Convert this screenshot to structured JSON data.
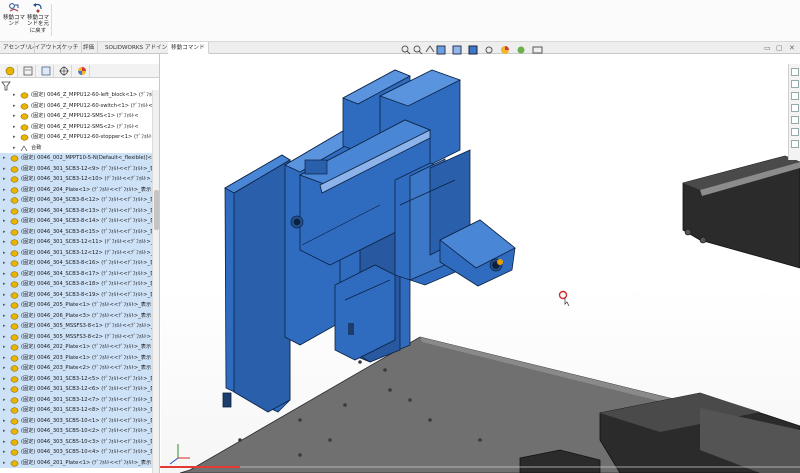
{
  "toolbar": {
    "buttons": [
      {
        "label": "移動コマ\nンド",
        "icon": "move-command-icon"
      },
      {
        "label": "移動コマ\nンドを元\nに戻す",
        "icon": "undo-move-icon"
      }
    ]
  },
  "tabs": [
    {
      "label": "アセンブリ",
      "active": false
    },
    {
      "label": "レイアウト",
      "active": false
    },
    {
      "label": "スケッチ",
      "active": false
    },
    {
      "label": "評価",
      "active": false
    },
    {
      "label": "SOLIDWORKS アドイン",
      "active": false
    },
    {
      "label": "移動コマンド",
      "active": true
    }
  ],
  "feature_tree": {
    "items": [
      {
        "text": "(固定) 0046_Z_MPPU12-60-left_block<1> (ﾃﾞﾌｫﾙﾄ<",
        "indent": 1,
        "sel": false
      },
      {
        "text": "(固定) 0046_Z_MPPU12-60-switch<1> (ﾃﾞﾌｫﾙﾄ<",
        "indent": 1,
        "sel": false
      },
      {
        "text": "(固定) 0046_Z_MPPU12-SMS<1> (ﾃﾞﾌｫﾙﾄ<",
        "indent": 1,
        "sel": false
      },
      {
        "text": "(固定) 0046_Z_MPPU12-SMS<2> (ﾃﾞﾌｫﾙﾄ<",
        "indent": 1,
        "sel": false
      },
      {
        "text": "(固定) 0046_Z_MPPU12-60-stopper<1> (ﾃﾞﾌｫﾙﾄ<",
        "indent": 1,
        "sel": false
      },
      {
        "text": "合致",
        "indent": 1,
        "sel": false,
        "mates": true
      },
      {
        "text": "(固定) 0046_002_MPPT10-5-N(Default<_flexible)]<1>",
        "indent": 0,
        "sel": true
      },
      {
        "text": "(固定) 0046_301_SCB3-12<9> (ﾃﾞﾌｫﾙﾄ<<ﾃﾞﾌｫﾙﾄ>_表示",
        "indent": 0,
        "sel": true
      },
      {
        "text": "(固定) 0046_301_SCB3-12<10> (ﾃﾞﾌｫﾙﾄ<<ﾃﾞﾌｫﾙﾄ>_表示",
        "indent": 0,
        "sel": true
      },
      {
        "text": "(固定) 0046_204_Plate<1> (ﾃﾞﾌｫﾙﾄ<<ﾃﾞﾌｫﾙﾄ>_表示",
        "indent": 0,
        "sel": true
      },
      {
        "text": "(固定) 0046_304_SCB3-8<12> (ﾃﾞﾌｫﾙﾄ<<ﾃﾞﾌｫﾙﾄ>_表示",
        "indent": 0,
        "sel": true
      },
      {
        "text": "(固定) 0046_304_SCB3-8<13> (ﾃﾞﾌｫﾙﾄ<<ﾃﾞﾌｫﾙﾄ>_表示",
        "indent": 0,
        "sel": true
      },
      {
        "text": "(固定) 0046_304_SCB3-8<14> (ﾃﾞﾌｫﾙﾄ<<ﾃﾞﾌｫﾙﾄ>_表示",
        "indent": 0,
        "sel": true
      },
      {
        "text": "(固定) 0046_304_SCB3-8<15> (ﾃﾞﾌｫﾙﾄ<<ﾃﾞﾌｫﾙﾄ>_表示",
        "indent": 0,
        "sel": true
      },
      {
        "text": "(固定) 0046_301_SCB3-12<11> (ﾃﾞﾌｫﾙﾄ<<ﾃﾞﾌｫﾙﾄ>_表示",
        "indent": 0,
        "sel": true
      },
      {
        "text": "(固定) 0046_301_SCB3-12<12> (ﾃﾞﾌｫﾙﾄ<<ﾃﾞﾌｫﾙﾄ>_表示",
        "indent": 0,
        "sel": true
      },
      {
        "text": "(固定) 0046_304_SCB3-8<16> (ﾃﾞﾌｫﾙﾄ<<ﾃﾞﾌｫﾙﾄ>_表示",
        "indent": 0,
        "sel": true
      },
      {
        "text": "(固定) 0046_304_SCB3-8<17> (ﾃﾞﾌｫﾙﾄ<<ﾃﾞﾌｫﾙﾄ>_表示",
        "indent": 0,
        "sel": true
      },
      {
        "text": "(固定) 0046_304_SCB3-8<18> (ﾃﾞﾌｫﾙﾄ<<ﾃﾞﾌｫﾙﾄ>_表示",
        "indent": 0,
        "sel": true
      },
      {
        "text": "(固定) 0046_304_SCB3-8<19> (ﾃﾞﾌｫﾙﾄ<<ﾃﾞﾌｫﾙﾄ>_表示",
        "indent": 0,
        "sel": true
      },
      {
        "text": "(固定) 0046_205_Plate<1> (ﾃﾞﾌｫﾙﾄ<<ﾃﾞﾌｫﾙﾄ>_表示",
        "indent": 0,
        "sel": true
      },
      {
        "text": "(固定) 0046_206_Plate<3> (ﾃﾞﾌｫﾙﾄ<<ﾃﾞﾌｫﾙﾄ>_表示",
        "indent": 0,
        "sel": true
      },
      {
        "text": "(固定) 0046_305_MSSFS3-8<1> (ﾃﾞﾌｫﾙﾄ<<ﾃﾞﾌｫﾙﾄ>_表示",
        "indent": 0,
        "sel": true
      },
      {
        "text": "(固定) 0046_305_MSSFS3-8<2> (ﾃﾞﾌｫﾙﾄ<<ﾃﾞﾌｫﾙﾄ>_表示",
        "indent": 0,
        "sel": true
      },
      {
        "text": "(固定) 0046_202_Plate<1> (ﾃﾞﾌｫﾙﾄ<<ﾃﾞﾌｫﾙﾄ>_表示",
        "indent": 0,
        "sel": true
      },
      {
        "text": "(固定) 0046_203_Plate<1> (ﾃﾞﾌｫﾙﾄ<<ﾃﾞﾌｫﾙﾄ>_表示",
        "indent": 0,
        "sel": true
      },
      {
        "text": "(固定) 0046_203_Plate<2> (ﾃﾞﾌｫﾙﾄ<<ﾃﾞﾌｫﾙﾄ>_表示",
        "indent": 0,
        "sel": true
      },
      {
        "text": "(固定) 0046_301_SCB3-12<5> (ﾃﾞﾌｫﾙﾄ<<ﾃﾞﾌｫﾙﾄ>_表示",
        "indent": 0,
        "sel": true
      },
      {
        "text": "(固定) 0046_301_SCB3-12<6> (ﾃﾞﾌｫﾙﾄ<<ﾃﾞﾌｫﾙﾄ>_表示",
        "indent": 0,
        "sel": true
      },
      {
        "text": "(固定) 0046_301_SCB3-12<7> (ﾃﾞﾌｫﾙﾄ<<ﾃﾞﾌｫﾙﾄ>_表示",
        "indent": 0,
        "sel": true
      },
      {
        "text": "(固定) 0046_301_SCB3-12<8> (ﾃﾞﾌｫﾙﾄ<<ﾃﾞﾌｫﾙﾄ>_表示",
        "indent": 0,
        "sel": true
      },
      {
        "text": "(固定) 0046_303_SCB5-10<1> (ﾃﾞﾌｫﾙﾄ<<ﾃﾞﾌｫﾙﾄ>_表示",
        "indent": 0,
        "sel": true
      },
      {
        "text": "(固定) 0046_303_SCB5-10<2> (ﾃﾞﾌｫﾙﾄ<<ﾃﾞﾌｫﾙﾄ>_表示",
        "indent": 0,
        "sel": true
      },
      {
        "text": "(固定) 0046_303_SCB5-10<3> (ﾃﾞﾌｫﾙﾄ<<ﾃﾞﾌｫﾙﾄ>_表示",
        "indent": 0,
        "sel": true
      },
      {
        "text": "(固定) 0046_303_SCB5-10<4> (ﾃﾞﾌｫﾙﾄ<<ﾃﾞﾌｫﾙﾄ>_表示",
        "indent": 0,
        "sel": true
      },
      {
        "text": "(固定) 0046_201_Plate<1> (ﾃﾞﾌｫﾙﾄ<<ﾃﾞﾌｫﾙﾄ>_表示",
        "indent": 0,
        "sel": true
      }
    ]
  },
  "colors": {
    "part_blue": "#2f6cc0",
    "part_edge": "#0c2140",
    "selection": "#cde1f7",
    "component_icon": "#e8b400",
    "plate_grey": "#6f6f6f"
  },
  "progress": 0.125
}
